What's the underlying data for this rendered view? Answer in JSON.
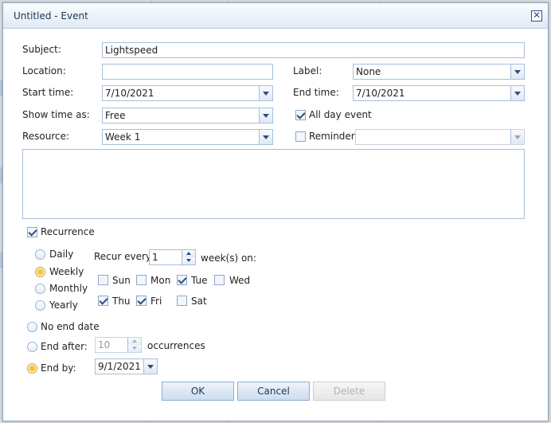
{
  "dialog": {
    "title": "Untitled - Event"
  },
  "form": {
    "subject_label": "Subject:",
    "subject_value": "Lightspeed",
    "location_label": "Location:",
    "location_value": "",
    "label_label": "Label:",
    "label_value": "None",
    "start_label": "Start time:",
    "start_value": "7/10/2021",
    "end_label": "End time:",
    "end_value": "7/10/2021",
    "showas_label": "Show time as:",
    "showas_value": "Free",
    "allday_label": "All day event",
    "allday_checked": true,
    "resource_label": "Resource:",
    "resource_value": "Week 1",
    "reminder_label": "Reminder",
    "reminder_checked": false,
    "reminder_value": ""
  },
  "recurrence": {
    "label": "Recurrence",
    "checked": true,
    "patterns": [
      "Daily",
      "Weekly",
      "Monthly",
      "Yearly"
    ],
    "selected_pattern": "Weekly",
    "recur_every_label": "Recur every",
    "recur_every_value": "1",
    "weeks_on_label": "week(s) on:",
    "days": {
      "sun": {
        "label": "Sun",
        "checked": false
      },
      "mon": {
        "label": "Mon",
        "checked": false
      },
      "tue": {
        "label": "Tue",
        "checked": true
      },
      "wed": {
        "label": "Wed",
        "checked": false
      },
      "thu": {
        "label": "Thu",
        "checked": true
      },
      "fri": {
        "label": "Fri",
        "checked": true
      },
      "sat": {
        "label": "Sat",
        "checked": false
      }
    },
    "no_end_label": "No end date",
    "end_after_label": "End after:",
    "end_after_value": "10",
    "occurrences_label": "occurrences",
    "end_by_label": "End by:",
    "end_by_value": "9/1/2021",
    "selected_range": "End by"
  },
  "buttons": {
    "ok": "OK",
    "cancel": "Cancel",
    "delete": "Delete"
  }
}
